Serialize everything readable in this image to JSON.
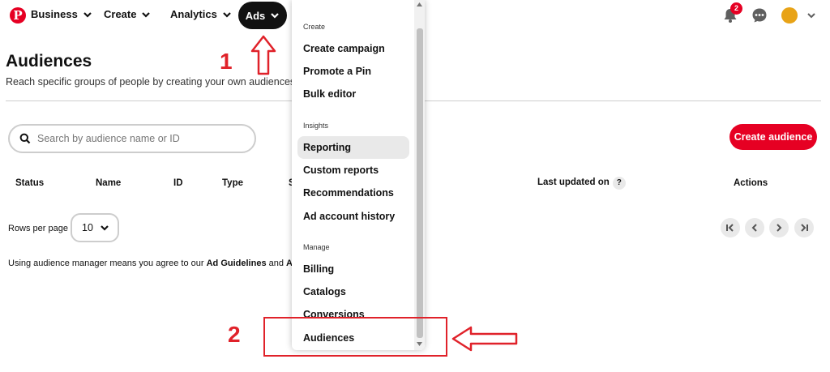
{
  "nav": {
    "logo": "P",
    "business": "Business",
    "create": "Create",
    "analytics": "Analytics",
    "ads": "Ads",
    "notification_count": "2"
  },
  "page": {
    "title": "Audiences",
    "subtitle": "Reach specific groups of people by creating your own audiences.",
    "search_placeholder": "Search by audience name or ID",
    "create_button": "Create audience"
  },
  "table": {
    "headers": {
      "status": "Status",
      "name": "Name",
      "id": "ID",
      "type": "Type",
      "s_partial": "S",
      "last_updated": "Last updated on",
      "actions": "Actions"
    },
    "help_glyph": "?"
  },
  "pagination": {
    "rows_per_page_label": "Rows per page",
    "rows_per_page_value": "10"
  },
  "legal": {
    "prefix": "Using audience manager means you agree to our ",
    "link1": "Ad Guidelines",
    "middle": " and ",
    "link2_partial": "Ad D"
  },
  "menu": {
    "sections": [
      {
        "label": "Create",
        "items": [
          "Create campaign",
          "Promote a Pin",
          "Bulk editor"
        ]
      },
      {
        "label": "Insights",
        "items": [
          "Reporting",
          "Custom reports",
          "Recommendations",
          "Ad account history"
        ]
      },
      {
        "label": "Manage",
        "items": [
          "Billing",
          "Catalogs",
          "Conversions",
          "Audiences"
        ]
      }
    ],
    "active_item": "Reporting"
  },
  "annotations": {
    "step1": "1",
    "step2": "2"
  },
  "colors": {
    "brand_red": "#e60023",
    "annotation_red": "#e0222a",
    "nav_active_bg": "#111111"
  },
  "icons": [
    "pinterest-logo-icon",
    "chevron-down-icon",
    "bell-icon",
    "chat-icon",
    "avatar-icon",
    "search-icon",
    "first-page-icon",
    "prev-page-icon",
    "next-page-icon",
    "last-page-icon"
  ]
}
